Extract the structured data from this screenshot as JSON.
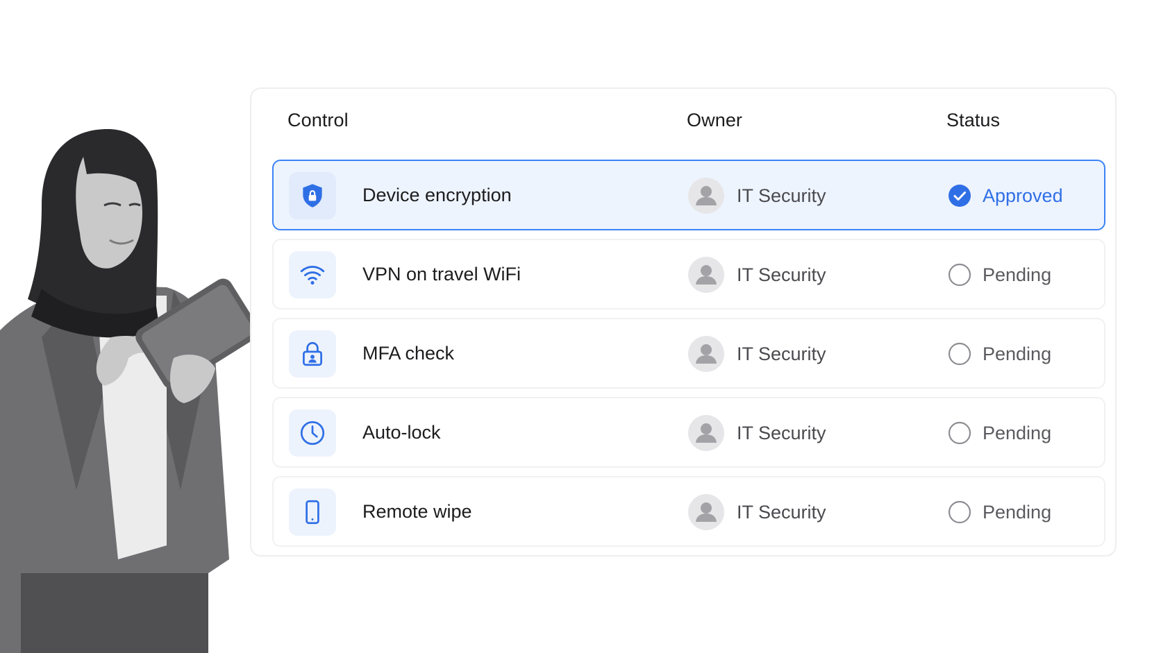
{
  "colors": {
    "accent": "#2f6fe6",
    "selected_row_bg": "#eef4fe",
    "selected_row_border": "#3b82f6",
    "pending": "#8e8e93"
  },
  "table": {
    "headers": {
      "control": "Control",
      "owner": "Owner",
      "status": "Status"
    },
    "rows": [
      {
        "icon": "shield-lock-icon",
        "control": "Device encryption",
        "owner": "IT Security",
        "status": "Approved",
        "selected": true
      },
      {
        "icon": "wifi-icon",
        "control": "VPN on travel WiFi",
        "owner": "IT Security",
        "status": "Pending",
        "selected": false
      },
      {
        "icon": "padlock-user-icon",
        "control": "MFA check",
        "owner": "IT Security",
        "status": "Pending",
        "selected": false
      },
      {
        "icon": "clock-icon",
        "control": "Auto-lock",
        "owner": "IT Security",
        "status": "Pending",
        "selected": false
      },
      {
        "icon": "smartphone-icon",
        "control": "Remote wipe",
        "owner": "IT Security",
        "status": "Pending",
        "selected": false
      }
    ]
  }
}
